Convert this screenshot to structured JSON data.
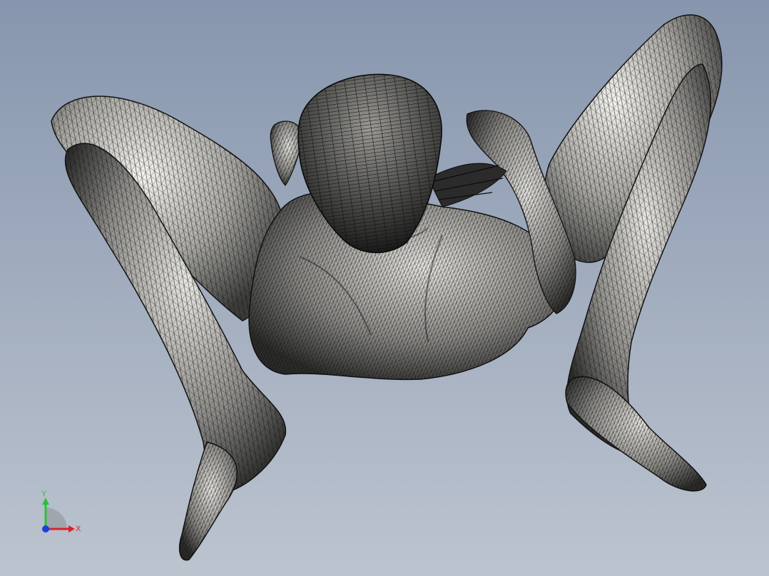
{
  "viewport": {
    "background_top": "#8796ae",
    "background_bottom": "#bcc4cf"
  },
  "model": {
    "display_mode": "shaded-with-mesh-edges",
    "surface_color": "#c9c8c3",
    "mesh_color": "#111111"
  },
  "triad": {
    "y_label": "Y",
    "x_label": "X",
    "y_color": "#2fbf3a",
    "x_color": "#d8232a",
    "z_color": "#1d3fd8"
  }
}
